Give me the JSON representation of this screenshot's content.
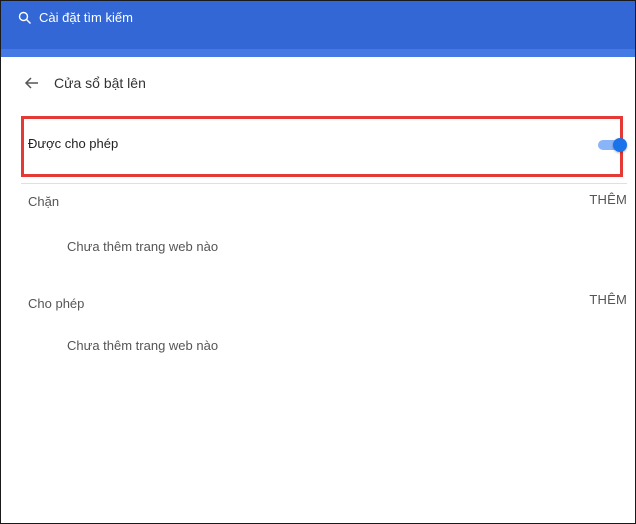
{
  "search": {
    "placeholder": "Cài đặt tìm kiếm"
  },
  "header": {
    "title": "Cửa sổ bật lên"
  },
  "toggle": {
    "label": "Được cho phép",
    "enabled": true,
    "accent": "#1a73e8"
  },
  "sections": [
    {
      "label": "Chặn",
      "add_label": "THÊM",
      "empty_text": "Chưa thêm trang web nào"
    },
    {
      "label": "Cho phép",
      "add_label": "THÊM",
      "empty_text": "Chưa thêm trang web nào"
    }
  ],
  "colors": {
    "topbar": "#3367d6",
    "highlight": "#e53935"
  }
}
